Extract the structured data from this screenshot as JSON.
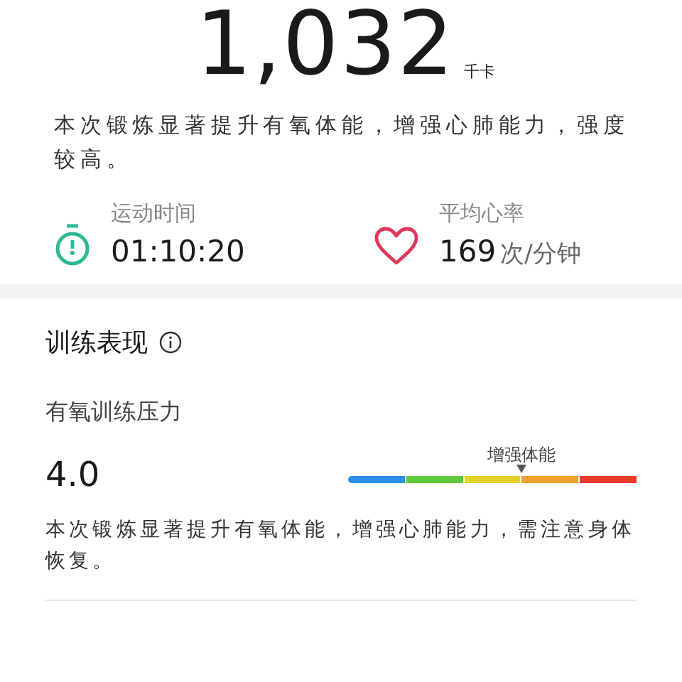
{
  "summary": {
    "calories": "1,032",
    "unit": "千卡",
    "description": "本次锻炼显著提升有氧体能，增强心肺能力，强度较高。"
  },
  "stats": [
    {
      "kind": "timer",
      "label": "运动时间",
      "value": "01:10:20"
    },
    {
      "kind": "heart",
      "label": "平均心率",
      "value": "169",
      "unit": "次/分钟"
    }
  ],
  "training": {
    "title": "训练表现",
    "metric": {
      "label": "有氧训练压力",
      "value": "4.0",
      "marker_label": "增强体能",
      "segments": [
        {
          "color": "#2f8fe6"
        },
        {
          "color": "#5ccc3c"
        },
        {
          "color": "#e3d22a"
        },
        {
          "color": "#f0a030"
        },
        {
          "color": "#ec3a2a"
        }
      ],
      "description": "本次锻炼显著提升有氧体能，增强心肺能力，需注意身体恢复。"
    }
  }
}
